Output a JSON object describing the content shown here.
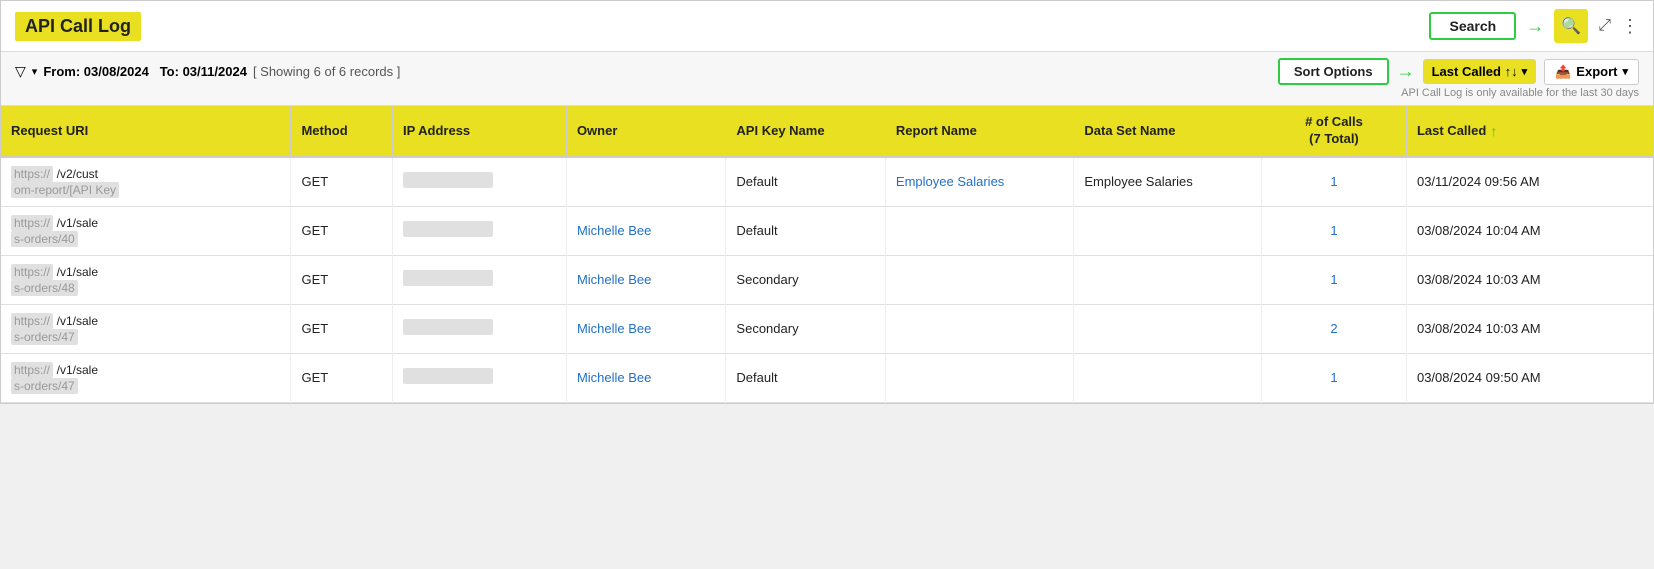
{
  "header": {
    "title": "API Call Log",
    "search_label": "Search",
    "search_icon": "🔍",
    "expand_icon": "⤢",
    "more_icon": "⋮"
  },
  "notice": "API Call Log is only available for the last 30 days",
  "filter": {
    "from_label": "From:",
    "from_date": "03/08/2024",
    "to_label": "To:",
    "to_date": "03/11/2024",
    "showing": "[ Showing 6 of 6 records ]"
  },
  "sort_options_label": "Sort Options",
  "sort_dropdown_label": "Last Called ↑↓",
  "export_label": "Export",
  "columns": [
    "Request URI",
    "Method",
    "IP Address",
    "Owner",
    "API Key Name",
    "Report Name",
    "Data Set Name",
    "# of Calls (7 Total)",
    "Last Called"
  ],
  "rows": [
    {
      "uri_base": "https://",
      "uri_base2": "om-report/[API Key",
      "uri_path": "/v2/cust",
      "method": "GET",
      "ip": "",
      "owner": "",
      "api_key": "Default",
      "report_name": "Employee Salaries",
      "report_link": true,
      "dataset": "Employee Salaries",
      "calls": "1",
      "calls_link": true,
      "last_called": "03/11/2024 09:56 AM"
    },
    {
      "uri_base": "https://",
      "uri_base2": "s-orders/40",
      "uri_path": "/v1/sale",
      "method": "GET",
      "ip": "",
      "owner": "Michelle Bee",
      "owner_link": true,
      "api_key": "Default",
      "report_name": "",
      "report_link": false,
      "dataset": "",
      "calls": "1",
      "calls_link": true,
      "last_called": "03/08/2024 10:04 AM"
    },
    {
      "uri_base": "https://",
      "uri_base2": "s-orders/48",
      "uri_path": "/v1/sale",
      "method": "GET",
      "ip": "",
      "owner": "Michelle Bee",
      "owner_link": true,
      "api_key": "Secondary",
      "report_name": "",
      "report_link": false,
      "dataset": "",
      "calls": "1",
      "calls_link": true,
      "last_called": "03/08/2024 10:03 AM"
    },
    {
      "uri_base": "https://",
      "uri_base2": "s-orders/47",
      "uri_path": "/v1/sale",
      "method": "GET",
      "ip": "",
      "owner": "Michelle Bee",
      "owner_link": true,
      "api_key": "Secondary",
      "report_name": "",
      "report_link": false,
      "dataset": "",
      "calls": "2",
      "calls_link": true,
      "last_called": "03/08/2024 10:03 AM"
    },
    {
      "uri_base": "https://",
      "uri_base2": "s-orders/47",
      "uri_path": "/v1/sale",
      "method": "GET",
      "ip": "",
      "owner": "Michelle Bee",
      "owner_link": true,
      "api_key": "Default",
      "report_name": "",
      "report_link": false,
      "dataset": "",
      "calls": "1",
      "calls_link": true,
      "last_called": "03/08/2024 09:50 AM"
    }
  ]
}
